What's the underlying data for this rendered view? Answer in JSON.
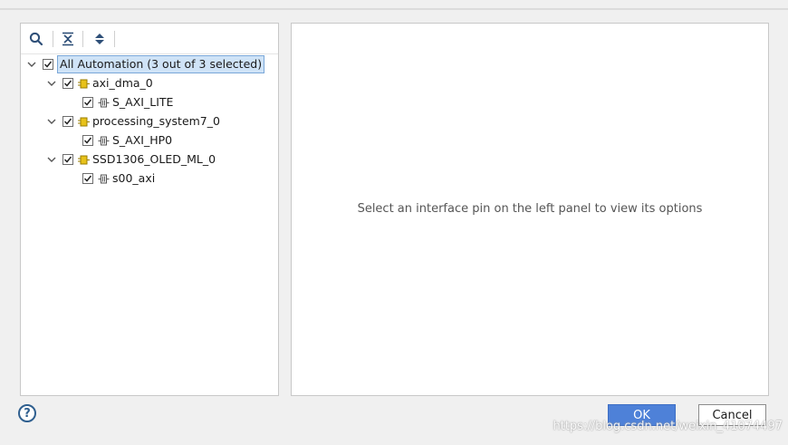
{
  "tree": {
    "root": {
      "label": "All Automation (3 out of 3 selected)",
      "checked": true,
      "expanded": true,
      "selected": true
    },
    "components": [
      {
        "label": "axi_dma_0",
        "checked": true,
        "expanded": true,
        "icon": "ip-block-icon",
        "interfaces": [
          {
            "label": "S_AXI_LITE",
            "checked": true,
            "icon": "interface-pin-icon"
          }
        ]
      },
      {
        "label": "processing_system7_0",
        "checked": true,
        "expanded": true,
        "icon": "ip-block-icon",
        "interfaces": [
          {
            "label": "S_AXI_HP0",
            "checked": true,
            "icon": "interface-pin-icon"
          }
        ]
      },
      {
        "label": "SSD1306_OLED_ML_0",
        "checked": true,
        "expanded": true,
        "icon": "ip-block-icon",
        "interfaces": [
          {
            "label": "s00_axi",
            "checked": true,
            "icon": "interface-pin-icon"
          }
        ]
      }
    ]
  },
  "toolbar": {
    "search_icon": "search-icon",
    "collapse_icon": "collapse-all-icon",
    "expand_icon": "expand-all-icon"
  },
  "right_panel": {
    "hint": "Select an interface pin on the left panel to view its options"
  },
  "footer": {
    "help_label": "?",
    "ok_label": "OK",
    "cancel_label": "Cancel"
  },
  "watermark": "https://blog.csdn.net/weixin_41074497",
  "colors": {
    "ok_button": "#4e81d8",
    "selection": "#cfe3f7",
    "ip_icon": "#e8c21a"
  }
}
